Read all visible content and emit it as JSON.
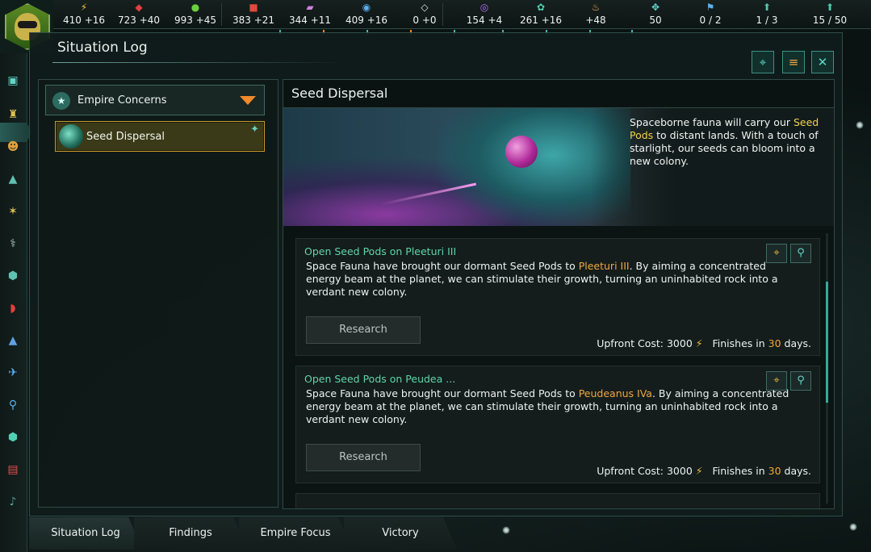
{
  "resources": [
    {
      "icon": "energy-icon",
      "glyph": "⚡",
      "color": "#f2c040",
      "value": "410 +16"
    },
    {
      "icon": "minerals-icon",
      "glyph": "◆",
      "color": "#e04040",
      "value": "723 +40"
    },
    {
      "icon": "food-icon",
      "glyph": "●",
      "color": "#6ad040",
      "value": "993 +45"
    },
    {
      "icon": "consumer-goods-icon",
      "glyph": "■",
      "color": "#e04a3a",
      "value": "383 +21"
    },
    {
      "icon": "alloys-icon",
      "glyph": "▰",
      "color": "#d080e0",
      "value": "344 +11"
    },
    {
      "icon": "influence-icon",
      "glyph": "◉",
      "color": "#5ab0f0",
      "value": "409 +16"
    },
    {
      "icon": "strategic-resource-icon",
      "glyph": "◇",
      "color": "#d8e4e2",
      "value": "0 +0"
    },
    {
      "icon": "research-icon",
      "glyph": "◎",
      "color": "#b070f0",
      "value": "154 +4"
    },
    {
      "icon": "unity-icon",
      "glyph": "✿",
      "color": "#50d0b0",
      "value": "261 +16"
    },
    {
      "icon": "amenities-icon",
      "glyph": "♨",
      "color": "#f0b050",
      "value": "+48"
    },
    {
      "icon": "fleet-icon",
      "glyph": "✥",
      "color": "#60d8c8",
      "value": "50"
    },
    {
      "icon": "starbase-icon",
      "glyph": "⚑",
      "color": "#5ab0f0",
      "value": "0 / 2"
    },
    {
      "icon": "colony-icon",
      "glyph": "⬆",
      "color": "#50c8b0",
      "value": "1 / 3"
    },
    {
      "icon": "fleet-capacity-icon",
      "glyph": "⬆",
      "color": "#50c8b0",
      "value": "15 / 50"
    }
  ],
  "window": {
    "title": "Situation Log",
    "buttons": {
      "locate": "⌖",
      "list": "≡",
      "close": "✕"
    }
  },
  "left_panel": {
    "category_label": "Empire Concerns",
    "category_icon": "★",
    "selected_item": "Seed Dispersal",
    "pin_glyph": "📌"
  },
  "right_panel": {
    "title": "Seed Dispersal",
    "description_pre": "Spaceborne fauna will carry our ",
    "description_highlight": "Seed Pods",
    "description_post": " to distant lands. With a touch of starlight, our seeds can bloom into a new colony."
  },
  "cards": [
    {
      "title": "Open Seed Pods on Pleeturi III",
      "body_pre": "Space Fauna have brought our dormant Seed Pods to ",
      "body_planet": "Pleeturi III",
      "body_post": ". By aiming a concentrated energy beam at the planet, we can stimulate their growth, turning an uninhabited rock into a verdant new colony.",
      "button": "Research",
      "cost_label": "Upfront Cost:",
      "cost_value": "3000",
      "finish_pre": "Finishes in",
      "finish_days": "30",
      "finish_post": "days."
    },
    {
      "title": "Open Seed Pods on Peudea ...",
      "body_pre": "Space Fauna have brought our dormant Seed Pods to ",
      "body_planet": "Peudeanus IVa",
      "body_post": ". By aiming a concentrated energy beam at the planet, we can stimulate their growth, turning an uninhabited rock into a verdant new colony.",
      "button": "Research",
      "cost_label": "Upfront Cost:",
      "cost_value": "3000",
      "finish_pre": "Finishes in",
      "finish_days": "30",
      "finish_post": "days."
    }
  ],
  "tabs": [
    "Situation Log",
    "Findings",
    "Empire Focus",
    "Victory"
  ],
  "active_tab": "Situation Log"
}
